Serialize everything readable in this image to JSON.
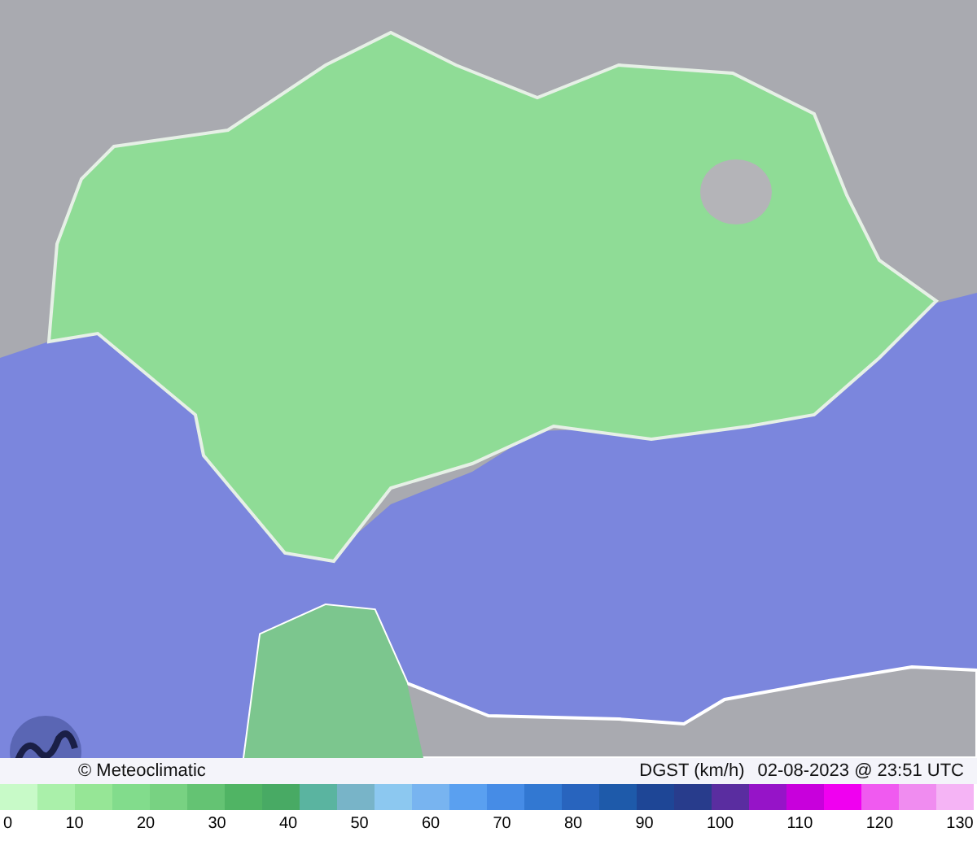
{
  "credit": "© Meteoclimatic",
  "title": "DGST (km/h)",
  "timestamp": "02-08-2023 @ 23:51 UTC",
  "scale": [
    {
      "color": "#c8fac8"
    },
    {
      "color": "#aaf0aa"
    },
    {
      "color": "#96e696"
    },
    {
      "color": "#82dc8c"
    },
    {
      "color": "#78d282"
    },
    {
      "color": "#64c373"
    },
    {
      "color": "#50b464"
    },
    {
      "color": "#48aa64"
    },
    {
      "color": "#5ab4a0"
    },
    {
      "color": "#78b4c8"
    },
    {
      "color": "#8cc8f0"
    },
    {
      "color": "#78b4f0"
    },
    {
      "color": "#5aa0f0"
    },
    {
      "color": "#468ce6"
    },
    {
      "color": "#3278d2"
    },
    {
      "color": "#2864be"
    },
    {
      "color": "#1e5aaa"
    },
    {
      "color": "#1e4696"
    },
    {
      "color": "#283c8c"
    },
    {
      "color": "#5a2da0"
    },
    {
      "color": "#9614c8"
    },
    {
      "color": "#c800dc"
    },
    {
      "color": "#f000f0"
    },
    {
      "color": "#f05af0"
    },
    {
      "color": "#f08cf0"
    },
    {
      "color": "#f5b4f5"
    }
  ],
  "ticks": [
    "0",
    "10",
    "20",
    "30",
    "40",
    "50",
    "60",
    "70",
    "80",
    "90",
    "100",
    "110",
    "120",
    "130"
  ]
}
